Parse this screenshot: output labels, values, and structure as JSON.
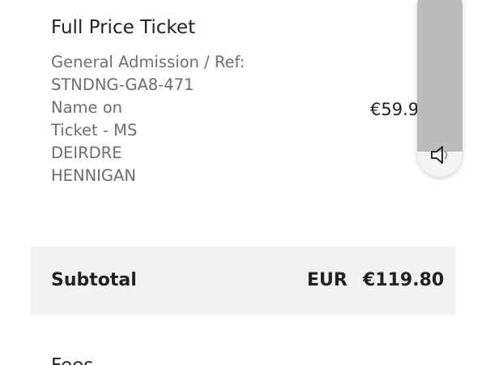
{
  "ticket": {
    "title": "Full Price Ticket",
    "details_lines": [
      "General Admission / Ref:",
      "STNDNG-GA8-471",
      "Name on",
      "Ticket - MS",
      "DEIRDRE",
      "HENNIGAN"
    ],
    "price": "€59.9"
  },
  "subtotal": {
    "label": "Subtotal",
    "currency": "EUR",
    "amount": "€119.80"
  },
  "next_section": {
    "heading": "Fees"
  },
  "volume_hud": {
    "icon": "speaker-icon",
    "level": 0.87
  },
  "colors": {
    "subtotal_background": "#f2f2f2",
    "details_text": "#6e6e6e",
    "primary_text": "#222222",
    "volume_fill": "#bcbcbc"
  }
}
